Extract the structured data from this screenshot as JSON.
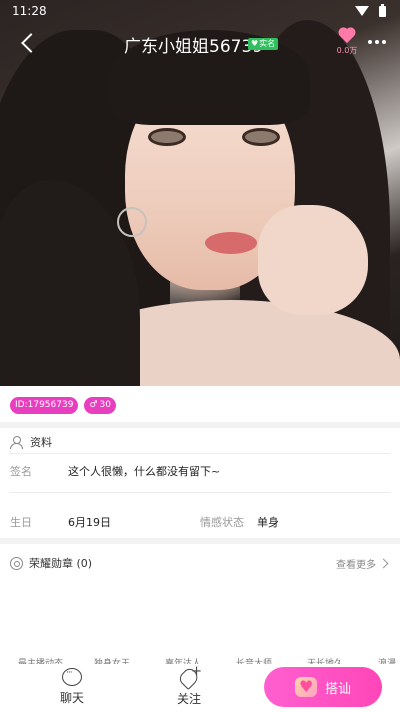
{
  "status_bar": {
    "time": "11:28"
  },
  "header": {
    "title": "广东小姐姐56739",
    "verified_label": "实名",
    "like_count": "0.0万"
  },
  "profile": {
    "id_badge": "ID:17956739",
    "level_badge": "30"
  },
  "info_section": {
    "title": "资料",
    "signature_label": "签名",
    "signature_value": "这个人很懒，什么都没有留下~",
    "birthday_label": "生日",
    "birthday_value": "6月19日",
    "relationship_label": "情感状态",
    "relationship_value": "单身"
  },
  "medals": {
    "title": "荣耀勋章 (0)",
    "see_more": "查看更多"
  },
  "tags": [
    "最主播动态",
    "独身女王",
    "嘉年达人",
    "长音大师",
    "天长地久",
    "浪漫"
  ],
  "bottom_bar": {
    "chat_label": "聊天",
    "follow_label": "关注",
    "chat_up_label": "搭讪"
  },
  "colors": {
    "accent_pink": "#e83ec0",
    "button_pink": "#ff46b8",
    "verified_green": "#2fbf5c"
  }
}
